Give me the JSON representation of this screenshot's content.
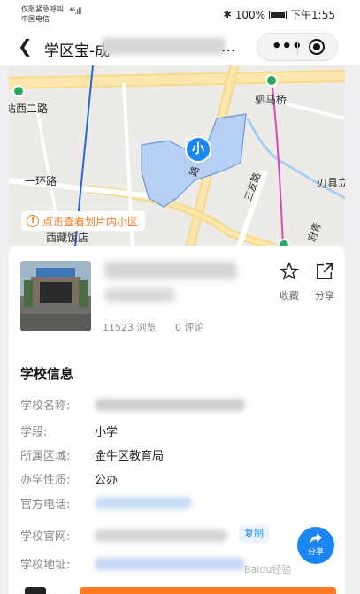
{
  "status_bar": {
    "carrier_line1": "仅限紧急呼叫",
    "carrier_line2": "中国电信",
    "signal": "⁴⁶.ıll",
    "battery": "100%",
    "time": "下午1:55"
  },
  "titlebar": {
    "title": "学区宝-成",
    "ellipsis": "..."
  },
  "map": {
    "labels": {
      "road_west2": "站西二路",
      "horse_bridge": "驷马桥",
      "ring1": "一环路",
      "sanyou": "三友路",
      "renbei": "刃具立",
      "fuqing": "府青",
      "xizang": "西藏饭店",
      "fushi": "路"
    },
    "pin_label": "小",
    "tip": "点击查看划片内小区"
  },
  "school": {
    "views": "11523 浏览",
    "comments": "0 评论",
    "favorite_label": "收藏",
    "share_label": "分享"
  },
  "info": {
    "section_title": "学校信息",
    "rows": [
      {
        "key": "学校名称:",
        "value": ""
      },
      {
        "key": "学段:",
        "value": "小学"
      },
      {
        "key": "所属区域:",
        "value": "金牛区教育局"
      },
      {
        "key": "办学性质:",
        "value": "公办"
      },
      {
        "key": "官方电话:",
        "value": ""
      },
      {
        "key": "学校官网:",
        "value": ""
      },
      {
        "key": "学校地址:",
        "value": ""
      }
    ],
    "copy_label": "复制"
  },
  "fab": {
    "label": "分享"
  },
  "watermark": "Baidu经验"
}
